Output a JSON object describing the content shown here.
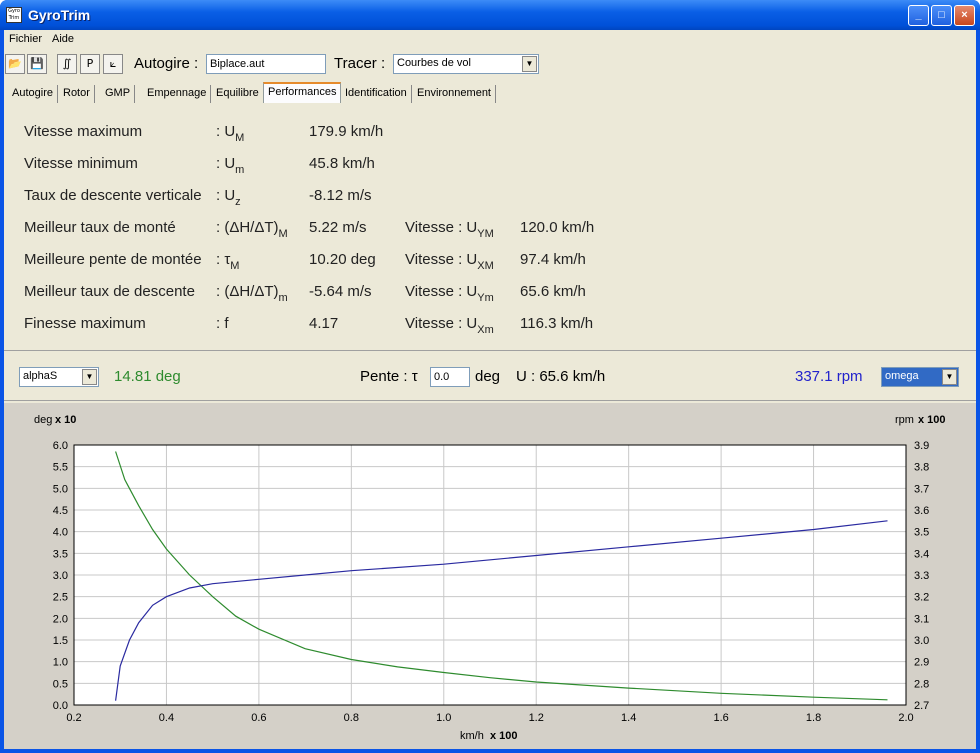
{
  "window": {
    "title": "GyroTrim",
    "icon_text": "Gyro Trim",
    "minimize": "_",
    "maximize": "□",
    "close": "×"
  },
  "menu": [
    "Fichier",
    "Aide"
  ],
  "toolbar": {
    "icons": [
      "open-folder-icon",
      "save-icon",
      "graph-tool-icon",
      "p-tool",
      "axes-tool-icon"
    ],
    "p_label": "P",
    "autogire_label": "Autogire :",
    "autogire_value": "Biplace.aut",
    "tracer_label": "Tracer :",
    "tracer_value": "Courbes de vol"
  },
  "tabs": [
    "Autogire",
    "Rotor",
    "GMP",
    "Empennage",
    "Equilibre",
    "Performances",
    "Identification",
    "Environnement"
  ],
  "active_tab": "Performances",
  "performances": [
    {
      "label": "Vitesse maximum",
      "sym": ": U",
      "sub": "M",
      "value": "179.9 km/h"
    },
    {
      "label": "Vitesse minimum",
      "sym": ": U",
      "sub": "m",
      "value": "45.8 km/h"
    },
    {
      "label": "Taux de descente verticale",
      "sym": ": U",
      "sub": "z",
      "value": "-8.12 m/s"
    },
    {
      "label": "Meilleur taux de monté",
      "sym": ": (ΔH/ΔT)",
      "sub": "M",
      "value": "5.22 m/s",
      "v_label": "Vitesse : U",
      "v_sub": "YM",
      "v_value": "120.0 km/h"
    },
    {
      "label": "Meilleure pente de montée",
      "sym": ": τ",
      "sub": "M",
      "value": "10.20 deg",
      "v_label": "Vitesse : U",
      "v_sub": "XM",
      "v_value": "97.4 km/h"
    },
    {
      "label": "Meilleur taux de descente",
      "sym": ": (ΔH/ΔT)",
      "sub": "m",
      "value": "-5.64 m/s",
      "v_label": "Vitesse : U",
      "v_sub": "Ym",
      "v_value": "65.6 km/h"
    },
    {
      "label": "Finesse maximum",
      "sym": ": f",
      "sub": "",
      "value": "4.17",
      "v_label": "Vitesse : U",
      "v_sub": "Xm",
      "v_value": "116.3 km/h"
    }
  ],
  "controls": {
    "left_select": "alphaS",
    "left_value": "14.81 deg",
    "pente_label": "Pente : τ",
    "pente_value": "0.0",
    "pente_unit": "deg",
    "u_text": "U : 65.6 km/h",
    "right_value": "337.1 rpm",
    "right_select": "omega",
    "colors": {
      "green": "#2e8b2e",
      "blue": "#2222cc"
    }
  },
  "chart_data": {
    "type": "line",
    "x_unit": "km/h",
    "x_mult": "x 100",
    "xlim": [
      0.2,
      2.0
    ],
    "xticks": [
      "0.2",
      "0.4",
      "0.6",
      "0.8",
      "1.0",
      "1.2",
      "1.4",
      "1.6",
      "1.8",
      "2.0"
    ],
    "y_left_unit": "deg",
    "y_left_mult": "x 10",
    "ylim_left": [
      0,
      6
    ],
    "yticks_left": [
      "0.0",
      "0.5",
      "1.0",
      "1.5",
      "2.0",
      "2.5",
      "3.0",
      "3.5",
      "4.0",
      "4.5",
      "5.0",
      "5.5",
      "6.0"
    ],
    "y_right_unit": "rpm",
    "y_right_mult": "x 100",
    "ylim_right": [
      2.7,
      3.9
    ],
    "yticks_right": [
      "2.7",
      "2.8",
      "2.9",
      "3.0",
      "3.1",
      "3.2",
      "3.3",
      "3.4",
      "3.5",
      "3.6",
      "3.7",
      "3.8",
      "3.9"
    ],
    "grid": true,
    "series": [
      {
        "axis": "left",
        "color": "#2e8b2e",
        "points": [
          [
            0.29,
            5.85
          ],
          [
            0.31,
            5.2
          ],
          [
            0.34,
            4.6
          ],
          [
            0.37,
            4.05
          ],
          [
            0.4,
            3.6
          ],
          [
            0.45,
            3.0
          ],
          [
            0.5,
            2.5
          ],
          [
            0.55,
            2.05
          ],
          [
            0.6,
            1.75
          ],
          [
            0.7,
            1.3
          ],
          [
            0.8,
            1.05
          ],
          [
            0.9,
            0.88
          ],
          [
            1.0,
            0.75
          ],
          [
            1.1,
            0.63
          ],
          [
            1.2,
            0.53
          ],
          [
            1.4,
            0.39
          ],
          [
            1.6,
            0.27
          ],
          [
            1.8,
            0.18
          ],
          [
            1.96,
            0.12
          ]
        ]
      },
      {
        "axis": "right",
        "color": "#2a2aa0",
        "points": [
          [
            0.29,
            2.72
          ],
          [
            0.3,
            2.88
          ],
          [
            0.32,
            3.0
          ],
          [
            0.34,
            3.08
          ],
          [
            0.37,
            3.16
          ],
          [
            0.4,
            3.2
          ],
          [
            0.45,
            3.24
          ],
          [
            0.5,
            3.26
          ],
          [
            0.6,
            3.28
          ],
          [
            0.7,
            3.3
          ],
          [
            0.8,
            3.32
          ],
          [
            1.0,
            3.35
          ],
          [
            1.2,
            3.39
          ],
          [
            1.4,
            3.43
          ],
          [
            1.6,
            3.47
          ],
          [
            1.8,
            3.51
          ],
          [
            1.96,
            3.55
          ]
        ]
      }
    ]
  }
}
